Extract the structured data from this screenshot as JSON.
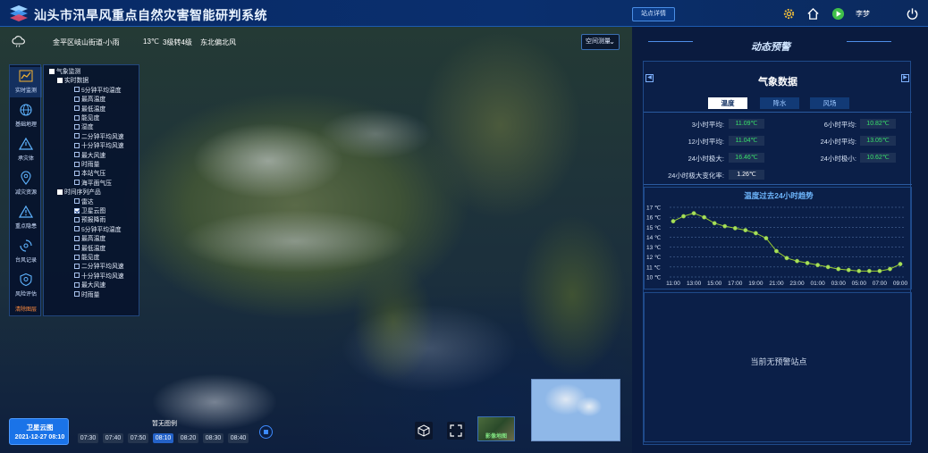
{
  "header": {
    "title": "汕头市汛旱风重点自然灾害智能研判系统",
    "site_details_button": "站点详情",
    "user_name": "李梦"
  },
  "weather_strip": {
    "location": "金平区岐山街道-小雨",
    "temperature": "13℃",
    "wind_level": "3级转4级",
    "wind_direction": "东北偏北风"
  },
  "space_measure": {
    "label": "空间测量"
  },
  "left_toolbar": {
    "items": [
      {
        "label": "实时监测",
        "icon": "chart-line-icon"
      },
      {
        "label": "基础地理",
        "icon": "globe-icon"
      },
      {
        "label": "承灾体",
        "icon": "warning-triangle-icon"
      },
      {
        "label": "减灾资源",
        "icon": "location-pin-icon"
      },
      {
        "label": "重点隐患",
        "icon": "alert-triangle-icon"
      },
      {
        "label": "台风记录",
        "icon": "typhoon-icon"
      },
      {
        "label": "风险评估",
        "icon": "shield-icon"
      }
    ],
    "legend_label": "清除图层"
  },
  "layer_tree": {
    "root": "气象监测",
    "groups": [
      {
        "label": "实时数据",
        "items": [
          "5分钟平均温度",
          "最高温度",
          "最低温度",
          "能见度",
          "湿度",
          "二分钟平均风速",
          "十分钟平均风速",
          "最大风速",
          "时雨量",
          "本站气压",
          "海平面气压"
        ]
      },
      {
        "label": "时间序列产品",
        "items": [
          "雷达",
          "卫星云图",
          "预报降雨",
          "5分钟平均温度",
          "最高温度",
          "最低温度",
          "能见度",
          "二分钟平均风速",
          "十分钟平均风速",
          "最大风速",
          "时雨量"
        ]
      }
    ],
    "checked_item": "卫星云图"
  },
  "timebar": {
    "product": "卫星云图",
    "datetime": "2021-12-27 08:10",
    "legend_label": "暂无图例",
    "times": [
      "07:30",
      "07:40",
      "07:50",
      "08:10",
      "08:20",
      "08:30",
      "08:40"
    ],
    "active_time": "08:10"
  },
  "basemap": {
    "label": "影像地图"
  },
  "right_panel": {
    "title": "动态预警",
    "card_title": "气象数据",
    "tabs": [
      "温度",
      "降水",
      "风场"
    ],
    "active_tab": "温度",
    "stats": [
      {
        "label": "3小时平均:",
        "value": "11.09℃"
      },
      {
        "label": "6小时平均:",
        "value": "10.82℃"
      },
      {
        "label": "12小时平均:",
        "value": "11.04℃"
      },
      {
        "label": "24小时平均:",
        "value": "13.05℃"
      },
      {
        "label": "24小时极大:",
        "value": "16.46℃"
      },
      {
        "label": "24小时极小:",
        "value": "10.62℃"
      },
      {
        "label": "24小时极大变化率:",
        "value": "1.26℃"
      }
    ],
    "no_warning_text": "当前无预警站点",
    "colors": {
      "accent": "#1a73e8",
      "value_green": "#38e06a",
      "chart_line": "#9acd32"
    }
  },
  "chart_data": {
    "type": "line",
    "title": "温度过去24小时趋势",
    "x": [
      "11:00",
      "12:00",
      "13:00",
      "14:00",
      "15:00",
      "16:00",
      "17:00",
      "18:00",
      "19:00",
      "20:00",
      "21:00",
      "22:00",
      "23:00",
      "00:00",
      "01:00",
      "02:00",
      "03:00",
      "04:00",
      "05:00",
      "06:00",
      "07:00",
      "08:00",
      "09:00"
    ],
    "x_tick_labels": [
      "11:00",
      "13:00",
      "15:00",
      "17:00",
      "19:00",
      "21:00",
      "23:00",
      "01:00",
      "03:00",
      "05:00",
      "07:00",
      "09:00"
    ],
    "series": [
      {
        "values": [
          15.6,
          16.1,
          16.4,
          16.0,
          15.4,
          15.1,
          14.9,
          14.7,
          14.4,
          13.9,
          12.6,
          11.9,
          11.6,
          11.4,
          11.2,
          11.0,
          10.8,
          10.7,
          10.6,
          10.6,
          10.6,
          10.8,
          11.3
        ]
      }
    ],
    "y_tick_labels": [
      "17 ℃",
      "16 ℃",
      "15 ℃",
      "14 ℃",
      "13 ℃",
      "12 ℃",
      "11 ℃",
      "10 ℃"
    ],
    "ylim": [
      10,
      17
    ],
    "grid": true
  }
}
